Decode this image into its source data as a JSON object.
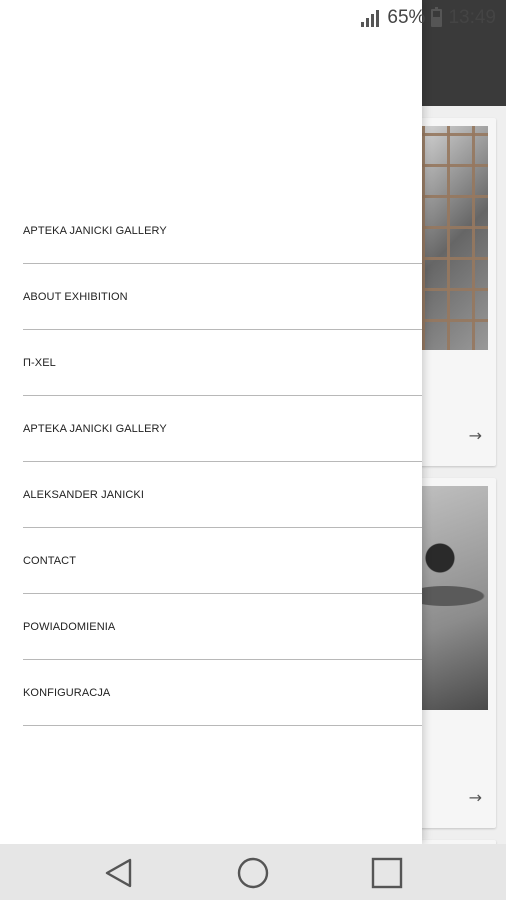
{
  "status_bar": {
    "battery_percent": "65%",
    "time": "13:49",
    "signal_icon": "signal-bars-icon",
    "battery_icon": "battery-icon"
  },
  "drawer": {
    "menu_items": [
      {
        "label": "APTEKA JANICKI GALLERY"
      },
      {
        "label": "ABOUT EXHIBITION"
      },
      {
        "label": "Π-XEL"
      },
      {
        "label": "APTEKA JANICKI GALLERY"
      },
      {
        "label": "ALEKSANDER JANICKI"
      },
      {
        "label": "CONTACT"
      },
      {
        "label": "POWIADOMIENIA"
      },
      {
        "label": "KONFIGURACJA"
      }
    ]
  },
  "background_cards": [
    {
      "arrow_icon": "arrow-right-icon",
      "arrow": "→"
    },
    {
      "arrow_icon": "arrow-right-icon",
      "arrow": "→"
    }
  ],
  "nav_bar": {
    "back_icon": "back-triangle-icon",
    "home_icon": "home-circle-icon",
    "recents_icon": "recents-square-icon"
  },
  "colors": {
    "app_bar": "#3a3a3a",
    "drawer_bg": "#ffffff",
    "divider": "#b8b8b8",
    "nav_bar": "#e6e6e6"
  }
}
